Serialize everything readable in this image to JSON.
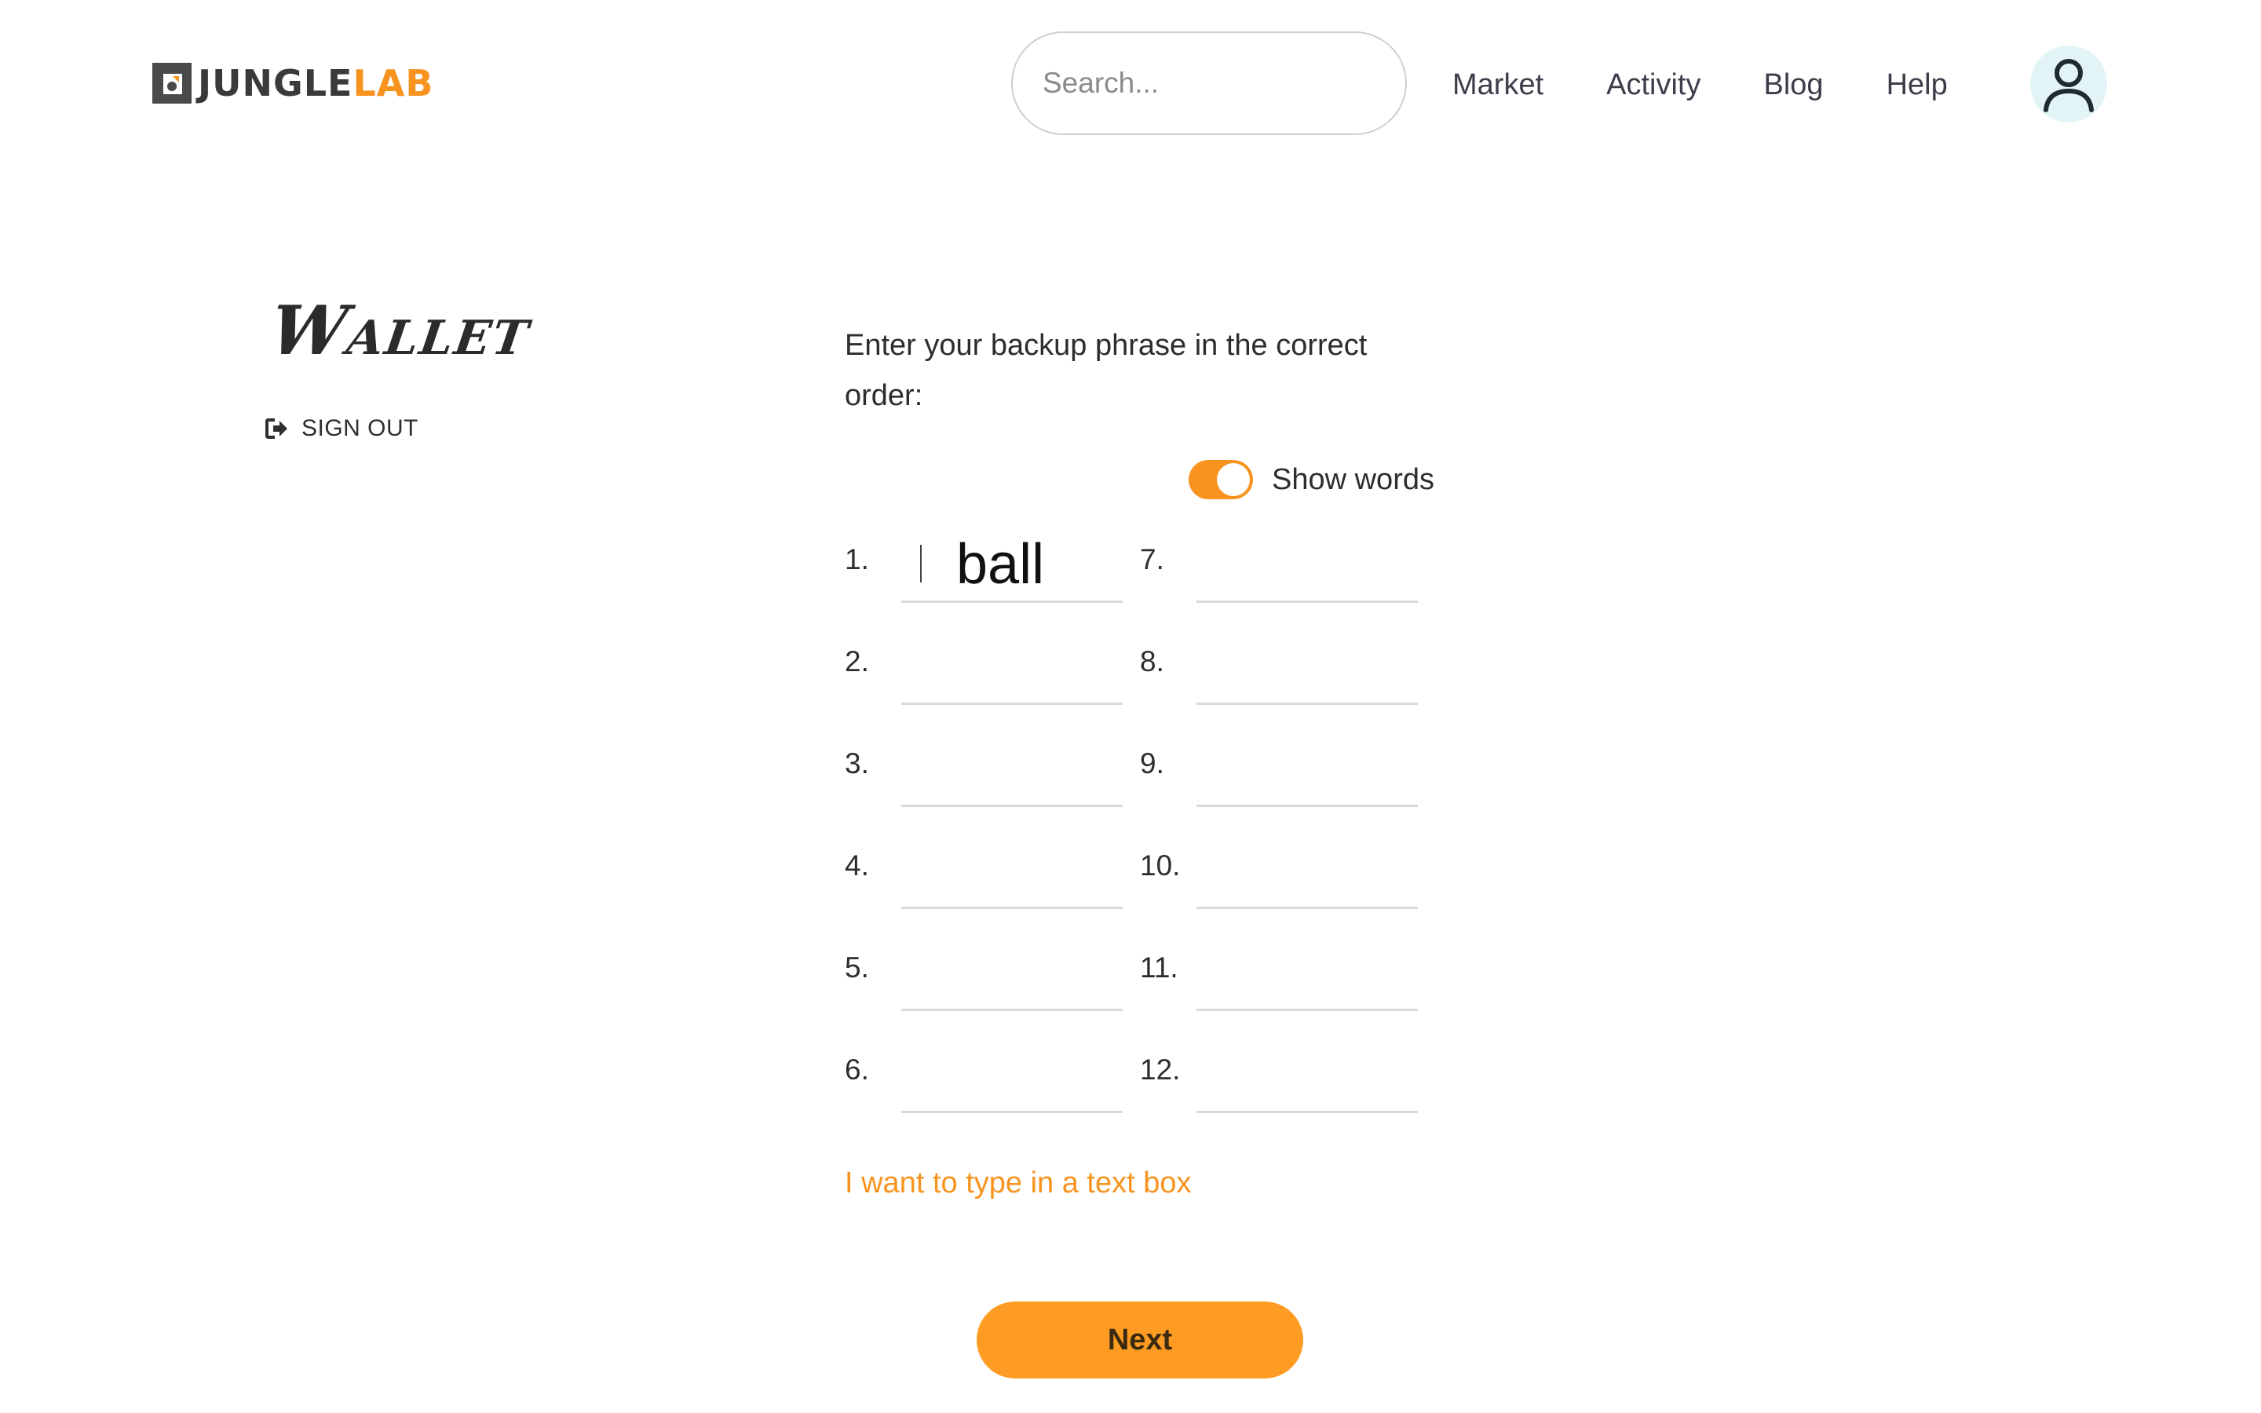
{
  "brand": {
    "name_part1": "JUNGLE",
    "name_part2": "LAB"
  },
  "search": {
    "placeholder": "Search...",
    "value": ""
  },
  "nav": {
    "items": [
      {
        "label": "Market"
      },
      {
        "label": "Activity"
      },
      {
        "label": "Blog"
      },
      {
        "label": "Help"
      }
    ]
  },
  "sidebar": {
    "title": "Wallet",
    "signout_label": "SIGN OUT"
  },
  "main": {
    "instructions": "Enter your backup phrase in the correct order:",
    "toggle": {
      "label": "Show words",
      "on": true
    },
    "words": [
      {
        "num": "1.",
        "value": "ball"
      },
      {
        "num": "2.",
        "value": ""
      },
      {
        "num": "3.",
        "value": ""
      },
      {
        "num": "4.",
        "value": ""
      },
      {
        "num": "5.",
        "value": ""
      },
      {
        "num": "6.",
        "value": ""
      },
      {
        "num": "7.",
        "value": ""
      },
      {
        "num": "8.",
        "value": ""
      },
      {
        "num": "9.",
        "value": ""
      },
      {
        "num": "10.",
        "value": ""
      },
      {
        "num": "11.",
        "value": ""
      },
      {
        "num": "12.",
        "value": ""
      }
    ],
    "text_box_link": "I want to type in a text box",
    "next_label": "Next"
  },
  "colors": {
    "accent": "#f7931e",
    "button": "#fd9b22",
    "avatar_bg": "#e2f4f6",
    "text": "#2d2d2d"
  },
  "icons": {
    "logo": "junglelab-logo-icon",
    "search": "search-icon",
    "avatar": "user-icon",
    "signout": "sign-out-icon"
  }
}
